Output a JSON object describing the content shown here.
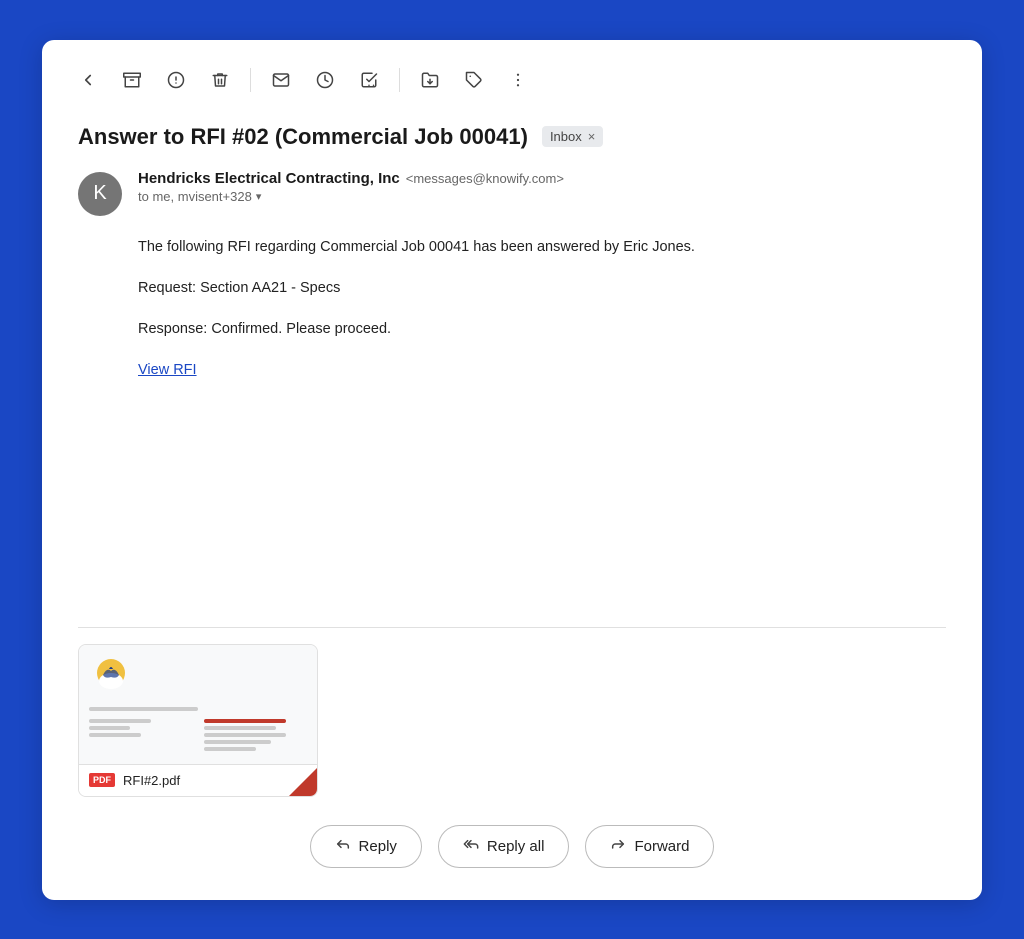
{
  "toolbar": {
    "back_label": "←",
    "archive_label": "⬇",
    "spam_label": "⊙",
    "delete_label": "🗑",
    "mark_unread_label": "✉",
    "snooze_label": "🕐",
    "add_task_label": "✔",
    "move_label": "📁",
    "label_label": "🏷",
    "more_label": "⋮"
  },
  "email": {
    "subject": "Answer to RFI #02 (Commercial Job 00041)",
    "badge": "Inbox",
    "badge_x": "×",
    "sender_name": "Hendricks Electrical Contracting, Inc",
    "sender_email": "<messages@knowify.com>",
    "sender_avatar": "K",
    "recipients": "to me, mvisent+328",
    "body_line1": "The following RFI regarding Commercial Job 00041 has been answered by Eric Jones.",
    "body_request": "Request: Section AA21 - Specs",
    "body_response": "Response: Confirmed. Please proceed.",
    "view_rfi_link": "View RFI"
  },
  "attachment": {
    "filename": "RFI#2.pdf",
    "type_badge": "PDF"
  },
  "actions": {
    "reply_label": "Reply",
    "reply_all_label": "Reply all",
    "forward_label": "Forward"
  }
}
